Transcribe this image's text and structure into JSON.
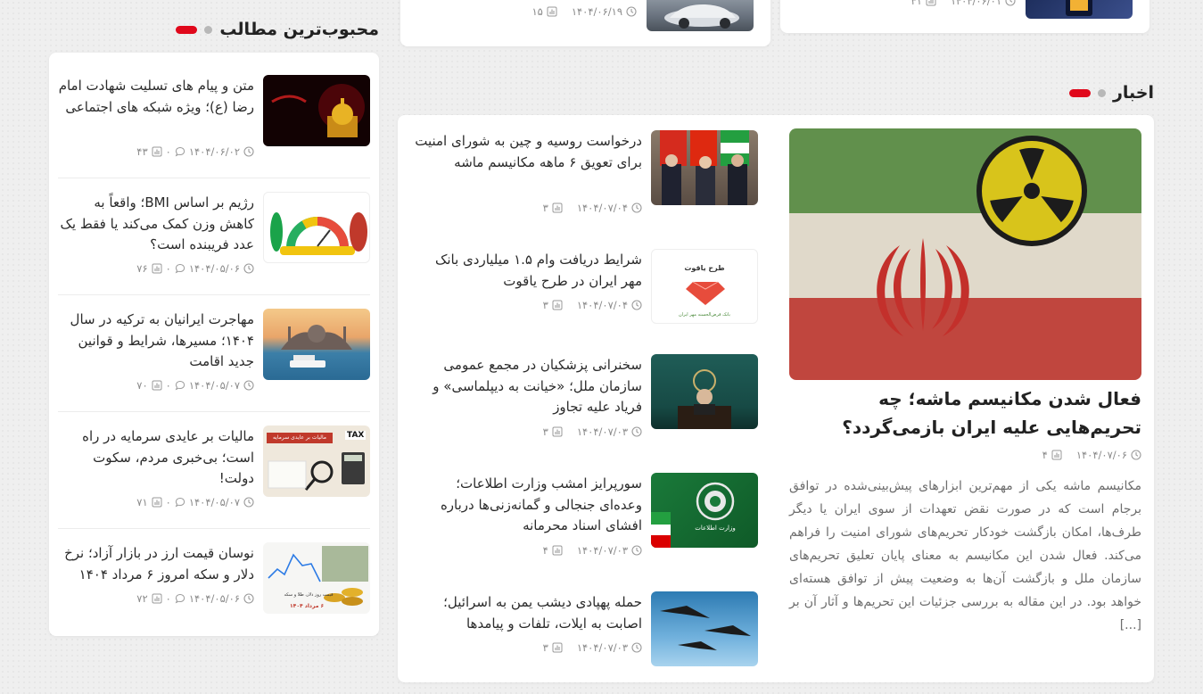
{
  "top_cards": [
    {
      "date": "۱۴۰۴/۰۶/۱۹",
      "views": "۱۵"
    },
    {
      "date": "۱۴۰۴/۰۶/۰۱",
      "views": "۳۱"
    }
  ],
  "popular": {
    "heading": "محبوب‌ترین مطالب",
    "items": [
      {
        "title": "متن و پیام های تسلیت شهادت امام رضا (ع)؛ ویژه شبکه های اجتماعی",
        "date": "۱۴۰۴/۰۶/۰۲",
        "comments": "۰",
        "views": "۴۳"
      },
      {
        "title": "رژیم بر اساس BMI؛ واقعاً به کاهش وزن کمک می‌کند یا فقط یک عدد فریبنده است؟",
        "date": "۱۴۰۴/۰۵/۰۶",
        "comments": "۰",
        "views": "۷۶"
      },
      {
        "title": "مهاجرت ایرانیان به ترکیه در سال ۱۴۰۴؛ مسیرها، شرایط و قوانین جدید اقامت",
        "date": "۱۴۰۴/۰۵/۰۷",
        "comments": "۰",
        "views": "۷۰"
      },
      {
        "title": "مالیات بر عایدی سرمایه در راه است؛ بی‌خبری مردم، سکوت دولت!",
        "date": "۱۴۰۴/۰۵/۰۷",
        "comments": "۰",
        "views": "۷۱"
      },
      {
        "title": "نوسان قیمت ارز در بازار آزاد؛ نرخ دلار و سکه امروز ۶ مرداد ۱۴۰۴",
        "date": "۱۴۰۴/۰۵/۰۶",
        "comments": "۰",
        "views": "۷۲"
      }
    ],
    "thumb_texts": {
      "bmi": "BMI",
      "tax_chip": "TAX",
      "tax_banner": "مالیات بر عایدی سرمایه",
      "currency_banner": "قیمت روز دلار، طلا و سکه",
      "currency_date": "۶ مرداد ۱۴۰۴"
    }
  },
  "news": {
    "heading": "اخبار",
    "featured": {
      "title": "فعال شدن مکانیسم ماشه؛ چه تحریم‌هایی علیه ایران بازمی‌گردد؟",
      "date": "۱۴۰۴/۰۷/۰۶",
      "views": "۴",
      "excerpt": "مکانیسم ماشه یکی از مهم‌ترین ابزارهای پیش‌بینی‌شده در توافق برجام است که در صورت نقض تعهدات از سوی ایران یا دیگر طرف‌ها، امکان بازگشت خودکار تحریم‌های شورای امنیت را فراهم می‌کند. فعال شدن این مکانیسم به معنای پایان تعلیق تحریم‌های سازمان ملل و بازگشت آن‌ها به وضعیت پیش از توافق هسته‌ای خواهد بود. در این مقاله به بررسی جزئیات این تحریم‌ها و آثار آن بر [...]"
    },
    "items": [
      {
        "title": "درخواست روسیه و چین به شورای امنیت برای تعویق ۶ ماهه مکانیسم ماشه",
        "date": "۱۴۰۴/۰۷/۰۴",
        "views": "۳"
      },
      {
        "title": "شرایط دریافت وام ۱.۵ میلیاردی بانک مهر ایران در طرح یاقوت",
        "date": "۱۴۰۴/۰۷/۰۴",
        "views": "۳"
      },
      {
        "title": "سخنرانی پزشکیان در مجمع عمومی سازمان ملل؛ «خیانت به دیپلماسی» و فریاد علیه تجاوز",
        "date": "۱۴۰۴/۰۷/۰۳",
        "views": "۳"
      },
      {
        "title": "سورپرایز امشب وزارت اطلاعات؛ وعده‌ای جنجالی و گمانه‌زنی‌ها درباره افشای اسناد محرمانه",
        "date": "۱۴۰۴/۰۷/۰۳",
        "views": "۴"
      },
      {
        "title": "حمله پهپادی دیشب یمن به اسرائیل؛ اصابت به ایلات، تلفات و پیامدها",
        "date": "۱۴۰۴/۰۷/۰۳",
        "views": "۳"
      }
    ],
    "thumb_texts": {
      "yaghoot_title": "طرح یاقوت",
      "yaghoot_bank": "بانک قرض‌الحسنه مهر ایران",
      "intel_label": "وزارت اطلاعات"
    }
  },
  "colors": {
    "accent": "#e0081b",
    "dot": "#b8b8b8",
    "meta": "#8a8a8a"
  }
}
